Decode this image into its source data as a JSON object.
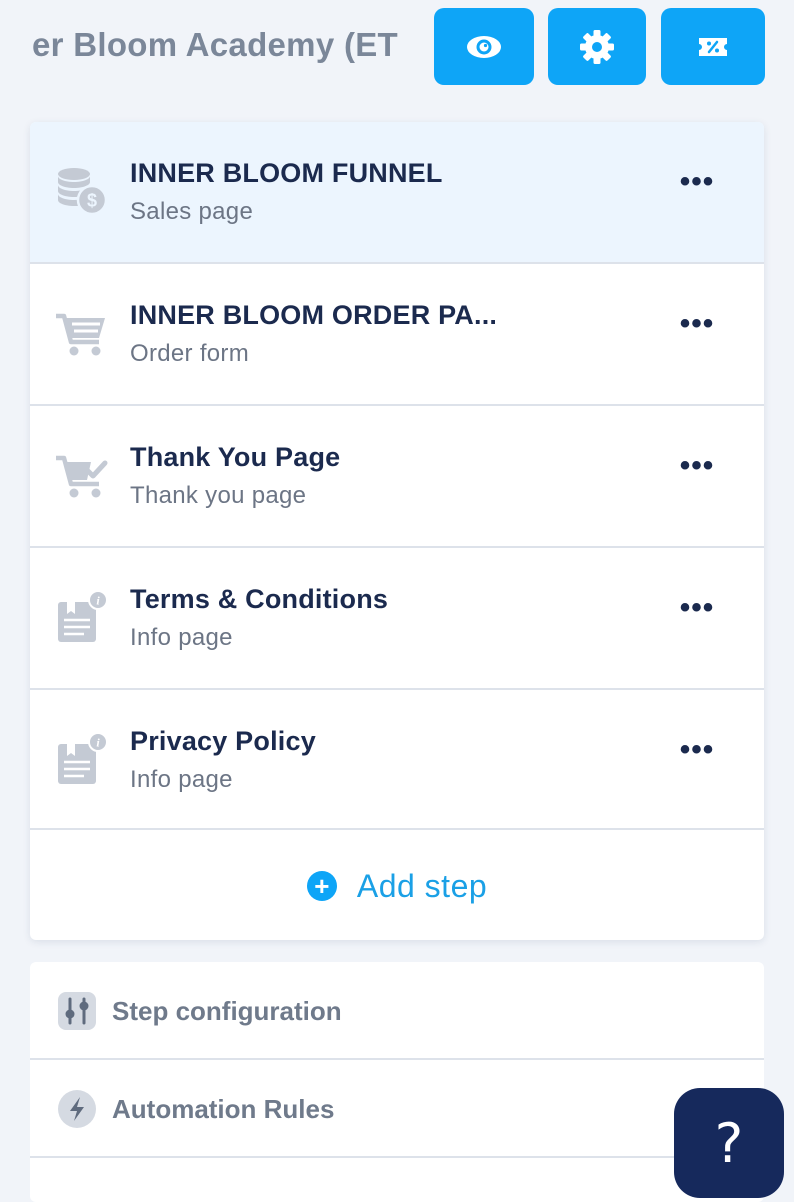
{
  "header": {
    "title": "Inner Bloom Academy (ET",
    "preview_icon": "eye-icon",
    "settings_icon": "gear-icon",
    "coupon_icon": "coupon-icon",
    "accent": "#0ea5f7"
  },
  "steps": [
    {
      "title": "INNER BLOOM FUNNEL",
      "subtitle": "Sales page",
      "icon": "coins-icon",
      "more": "•••"
    },
    {
      "title": "INNER BLOOM ORDER PA...",
      "subtitle": "Order form",
      "icon": "cart-icon",
      "more": "•••"
    },
    {
      "title": "Thank You Page",
      "subtitle": "Thank you page",
      "icon": "cart-check-icon",
      "more": "•••"
    },
    {
      "title": "Terms & Conditions",
      "subtitle": "Info page",
      "icon": "info-page-icon",
      "more": "•••"
    },
    {
      "title": "Privacy Policy",
      "subtitle": "Info page",
      "icon": "info-page-icon",
      "more": "•••"
    }
  ],
  "add_step": {
    "label": "Add step",
    "icon": "plus-circle-icon"
  },
  "config": [
    {
      "label": "Step configuration",
      "icon": "sliders-icon"
    },
    {
      "label": "Automation Rules",
      "icon": "bolt-icon"
    }
  ],
  "help": {
    "label": "?",
    "icon": "help-icon"
  }
}
